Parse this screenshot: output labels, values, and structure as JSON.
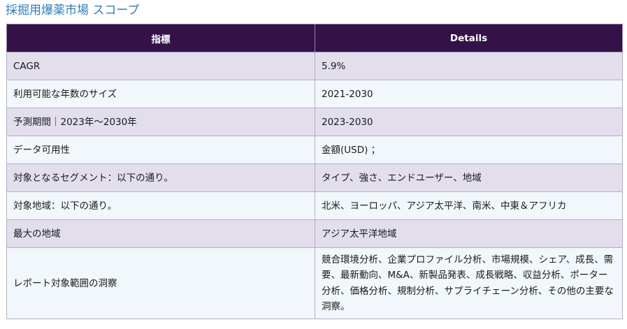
{
  "page": {
    "title": "採掘用爆薬市場 スコープ"
  },
  "table": {
    "headers": [
      "指標",
      "Details"
    ],
    "rows": [
      {
        "metric": "CAGR",
        "detail": "5.9%"
      },
      {
        "metric": "利用可能な年数のサイズ",
        "detail": "2021-2030"
      },
      {
        "metric": "予測期間｜2023年～2030年",
        "detail": "2023-2030"
      },
      {
        "metric": "データ可用性",
        "detail": "金額(USD) ；"
      },
      {
        "metric": "対象となるセグメント：以下の通り。",
        "detail": "タイプ、強さ、エンドユーザー、地域"
      },
      {
        "metric": "対象地域：以下の通り。",
        "detail": "北米、ヨーロッパ、アジア太平洋、南米、中東＆アフリカ"
      },
      {
        "metric": "最大の地域",
        "detail": "アジア太平洋地域"
      },
      {
        "metric": "レポート対象範囲の洞察",
        "detail": "競合環境分析、企業プロファイル分析、市場規模、シェア、成長、需要、最新動向、M&A、新製品発表、成長戦略、収益分析、ポーター分析、価格分析、規制分析、サプライチェーン分析、その他の主要な洞察。"
      }
    ]
  }
}
